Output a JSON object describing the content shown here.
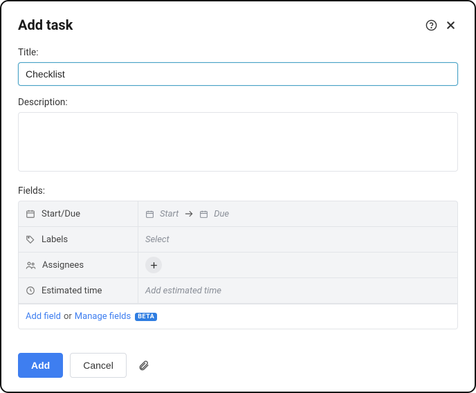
{
  "header": {
    "title": "Add task"
  },
  "form": {
    "title_label": "Title:",
    "title_value": "Checklist",
    "description_label": "Description:",
    "description_value": ""
  },
  "fields": {
    "label": "Fields:",
    "rows": [
      {
        "name": "Start/Due",
        "start_placeholder": "Start",
        "due_placeholder": "Due"
      },
      {
        "name": "Labels",
        "placeholder": "Select"
      },
      {
        "name": "Assignees"
      },
      {
        "name": "Estimated time",
        "placeholder": "Add estimated time"
      }
    ],
    "footer": {
      "add_field": "Add field",
      "or": "or",
      "manage_fields": "Manage fields",
      "beta": "BETA"
    }
  },
  "actions": {
    "add": "Add",
    "cancel": "Cancel"
  }
}
